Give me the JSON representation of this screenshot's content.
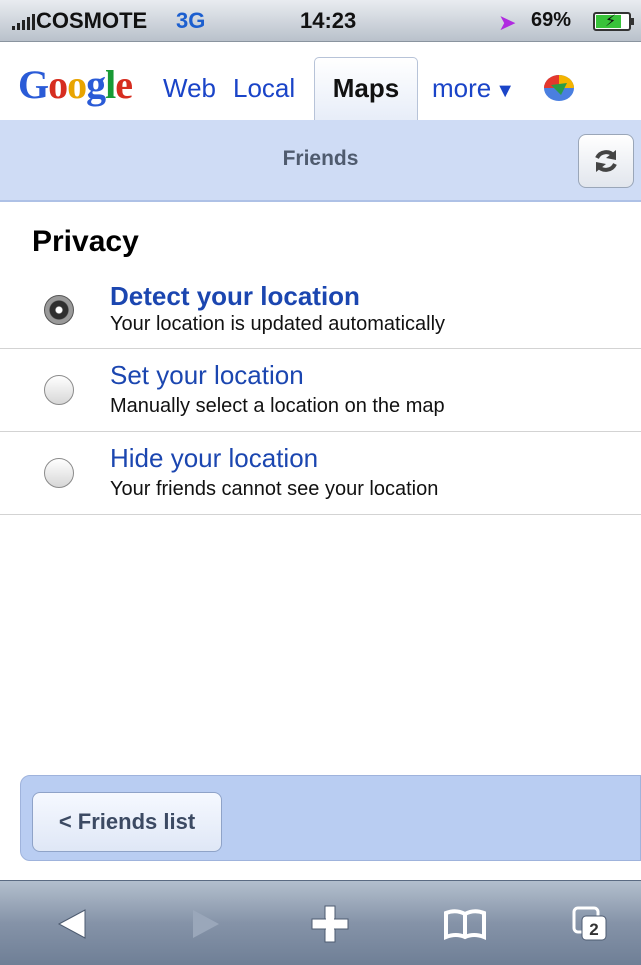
{
  "status_bar": {
    "carrier": "COSMOTE",
    "network": "3G",
    "time": "14:23",
    "battery_percent": "69%",
    "icons": [
      "signal-icon",
      "location-arrow-icon",
      "battery-charging-icon"
    ]
  },
  "google_nav": {
    "logo": "Google",
    "links": {
      "web": "Web",
      "local": "Local",
      "maps": "Maps",
      "more": "more"
    },
    "more_caret": "▼",
    "active_tab": "Maps",
    "colors": {
      "link": "#1a44c8"
    }
  },
  "toolbar": {
    "title": "Friends",
    "refresh_icon": "refresh-icon"
  },
  "privacy": {
    "heading": "Privacy",
    "options": [
      {
        "title": "Detect your location",
        "description": "Your location is updated automatically",
        "selected": true
      },
      {
        "title": "Set your location",
        "description": "Manually select a location on the map",
        "selected": false
      },
      {
        "title": "Hide your location",
        "description": "Your friends cannot see your location",
        "selected": false
      }
    ]
  },
  "bottom": {
    "friends_list_button": "< Friends list"
  },
  "safari_toolbar": {
    "pages_count": "2",
    "icons": [
      "back-arrow-icon",
      "forward-arrow-icon",
      "add-icon",
      "bookmarks-icon",
      "pages-icon"
    ]
  }
}
